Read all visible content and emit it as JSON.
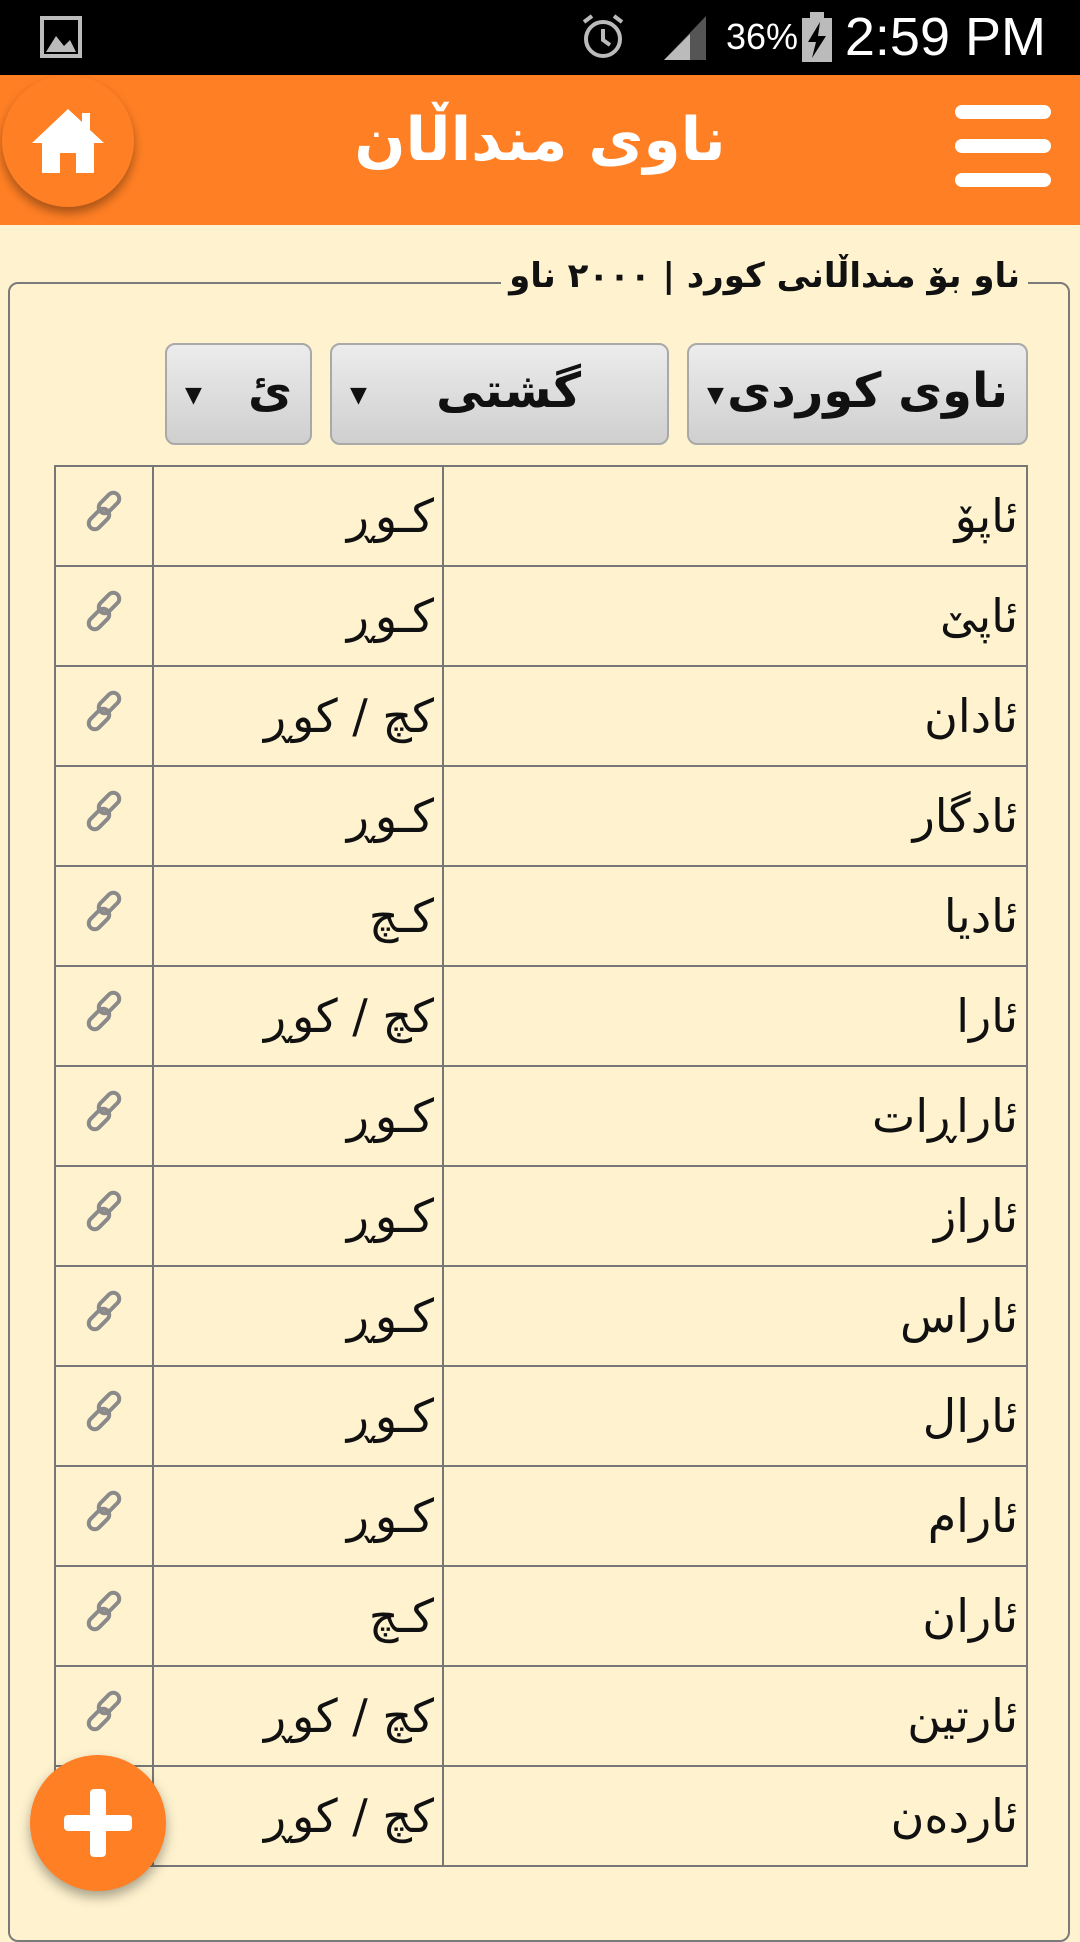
{
  "status_bar": {
    "time": "2:59 PM",
    "battery_percent": "36%",
    "icons": [
      "gallery-icon",
      "alarm-icon",
      "signal-icon",
      "battery-charging-icon"
    ]
  },
  "header": {
    "title": "ناوی منداڵان",
    "accent_color": "#ff7f24"
  },
  "panel": {
    "legend": "ناو بۆ منداڵانی کورد | ٢٠٠٠ ناو"
  },
  "filters": {
    "name_type": "ناوی کوردی",
    "category": "گشتی",
    "letter": "ئ"
  },
  "names": [
    {
      "name": "ئاپۆ",
      "gender": "کـوڕ"
    },
    {
      "name": "ئاپێ",
      "gender": "کـوڕ"
    },
    {
      "name": "ئادان",
      "gender": "کچ / کوڕ"
    },
    {
      "name": "ئادگار",
      "gender": "کـوڕ"
    },
    {
      "name": "ئادیا",
      "gender": "کـچ"
    },
    {
      "name": "ئارا",
      "gender": "کچ / کوڕ"
    },
    {
      "name": "ئاراڕات",
      "gender": "کـوڕ"
    },
    {
      "name": "ئاراز",
      "gender": "کـوڕ"
    },
    {
      "name": "ئاراس",
      "gender": "کـوڕ"
    },
    {
      "name": "ئارال",
      "gender": "کـوڕ"
    },
    {
      "name": "ئارام",
      "gender": "کـوڕ"
    },
    {
      "name": "ئاران",
      "gender": "کـچ"
    },
    {
      "name": "ئارتین",
      "gender": "کچ / کوڕ"
    },
    {
      "name": "ئاردەن",
      "gender": "کچ / کوڕ"
    }
  ]
}
